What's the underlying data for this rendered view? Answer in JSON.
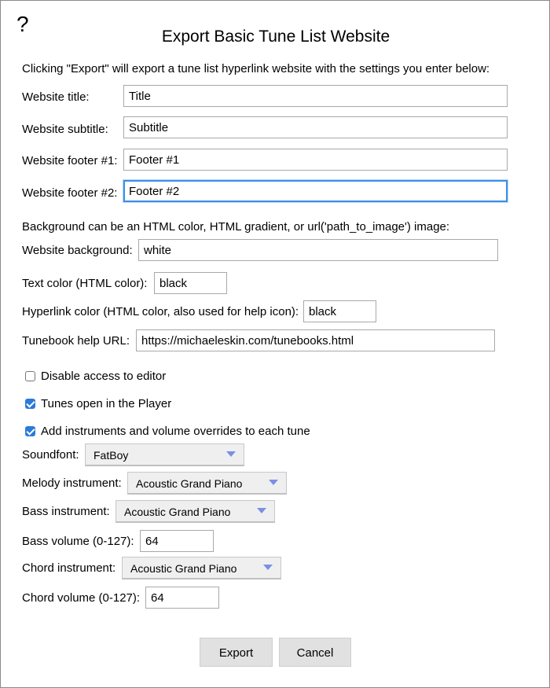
{
  "dialog": {
    "help_icon": "?",
    "title": "Export Basic Tune List Website",
    "intro": "Clicking \"Export\" will export a tune list hyperlink website with the settings you enter below:"
  },
  "fields": {
    "website_title": {
      "label": "Website title:",
      "value": "Title"
    },
    "website_subtitle": {
      "label": "Website subtitle:",
      "value": "Subtitle"
    },
    "footer1": {
      "label": "Website footer #1:",
      "value": "Footer #1"
    },
    "footer2": {
      "label": "Website footer #2:",
      "value": "Footer #2"
    },
    "background_note": "Background can be an HTML color, HTML gradient, or url('path_to_image') image:",
    "background": {
      "label": "Website background:",
      "value": "white"
    },
    "text_color": {
      "label": "Text color (HTML color):",
      "value": "black"
    },
    "hyperlink_color": {
      "label": "Hyperlink color (HTML color, also used for help icon):",
      "value": "black"
    },
    "help_url": {
      "label": "Tunebook help URL:",
      "value": "https://michaeleskin.com/tunebooks.html"
    }
  },
  "options": {
    "disable_editor": {
      "label": "Disable access to editor",
      "checked": false
    },
    "open_in_player": {
      "label": "Tunes open in the Player",
      "checked": true
    },
    "add_instruments": {
      "label": "Add instruments and volume overrides to each tune",
      "checked": true
    }
  },
  "instruments": {
    "soundfont": {
      "label": "Soundfont:",
      "selected": "FatBoy"
    },
    "melody": {
      "label": "Melody instrument:",
      "selected": "Acoustic Grand Piano"
    },
    "bass": {
      "label": "Bass instrument:",
      "selected": "Acoustic Grand Piano"
    },
    "bass_volume": {
      "label": "Bass volume (0-127):",
      "value": "64"
    },
    "chord": {
      "label": "Chord instrument:",
      "selected": "Acoustic Grand Piano"
    },
    "chord_volume": {
      "label": "Chord volume (0-127):",
      "value": "64"
    }
  },
  "buttons": {
    "export": "Export",
    "cancel": "Cancel"
  },
  "colors": {
    "focus_ring": "#3b8fe6",
    "checkbox_checked": "#2b7bd8",
    "select_arrow": "#7b8fe4",
    "button_bg": "#e1e1e1"
  }
}
